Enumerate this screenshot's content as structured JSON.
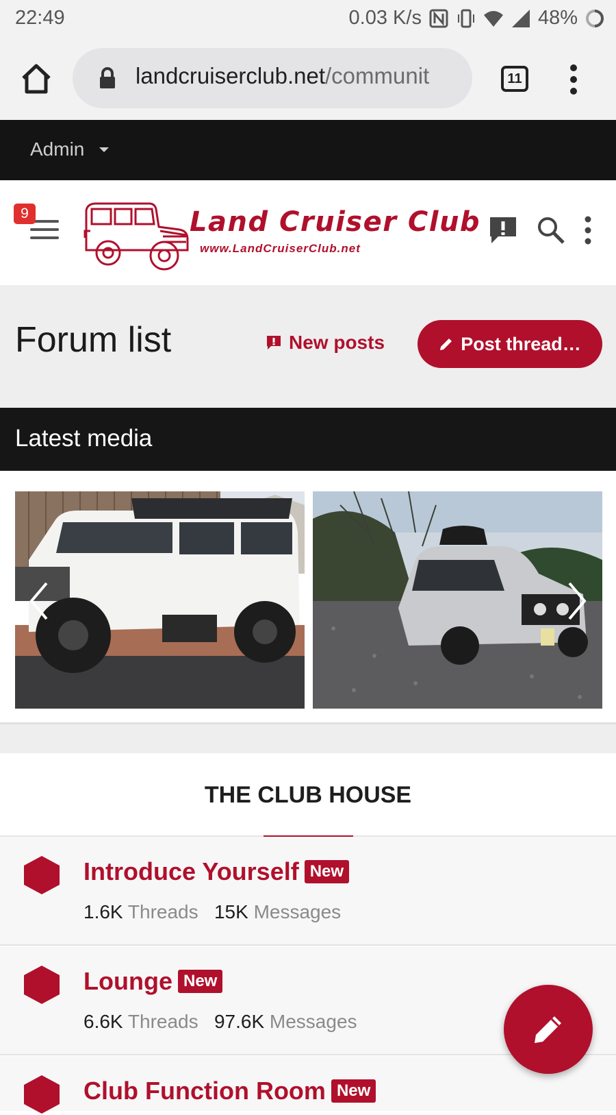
{
  "status_bar": {
    "time": "22:49",
    "speed": "0.03 K/s",
    "battery": "48%"
  },
  "browser": {
    "url_host": "landcruiserclub.net",
    "url_path": "/communit",
    "tab_count": "11"
  },
  "admin_bar": {
    "label": "Admin"
  },
  "header": {
    "notification_count": "9",
    "logo_title": "Land Cruiser Club",
    "logo_site": "www.LandCruiserClub.net"
  },
  "page": {
    "title": "Forum list",
    "new_posts_label": "New posts",
    "post_thread_label": "Post thread…"
  },
  "latest_media": {
    "heading": "Latest media"
  },
  "category": {
    "title": "THE CLUB HOUSE",
    "forums": [
      {
        "name": "Introduce Yourself",
        "badge": "New",
        "threads_value": "1.6K",
        "threads_label": "Threads",
        "messages_value": "15K",
        "messages_label": "Messages"
      },
      {
        "name": "Lounge",
        "badge": "New",
        "threads_value": "6.6K",
        "threads_label": "Threads",
        "messages_value": "97.6K",
        "messages_label": "Messages"
      },
      {
        "name": "Club Function Room",
        "badge": "New"
      }
    ]
  },
  "colors": {
    "accent": "#b0102c",
    "dark_bar": "#141414",
    "page_bg": "#eeeeee"
  }
}
